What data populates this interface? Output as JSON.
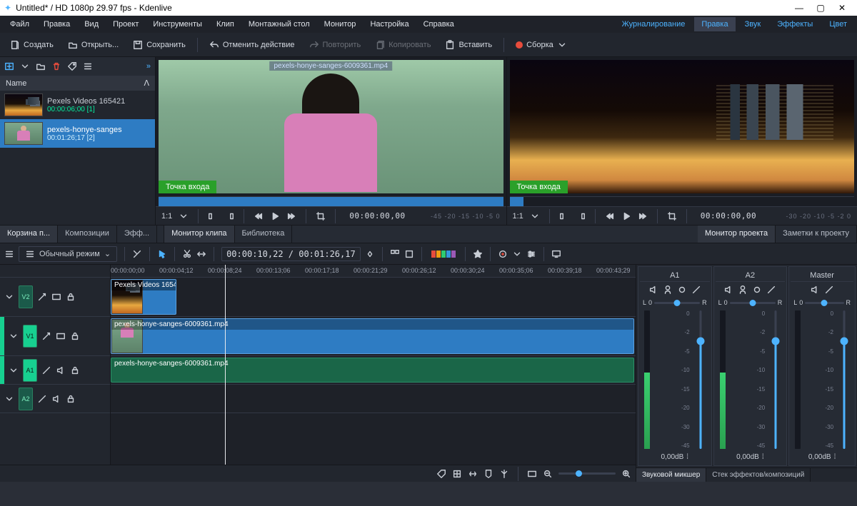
{
  "window": {
    "title": "Untitled* / HD 1080p 29.97 fps - Kdenlive"
  },
  "menu": {
    "items": [
      "Файл",
      "Правка",
      "Вид",
      "Проект",
      "Инструменты",
      "Клип",
      "Монтажный стол",
      "Монитор",
      "Настройка",
      "Справка"
    ],
    "right": [
      "Журналирование",
      "Правка",
      "Звук",
      "Эффекты",
      "Цвет"
    ]
  },
  "toolbar": {
    "new": "Создать",
    "open": "Открыть...",
    "save": "Сохранить",
    "undo": "Отменить действие",
    "redo": "Повторить",
    "copy": "Копировать",
    "paste": "Вставить",
    "render": "Сборка"
  },
  "bin": {
    "header": "Name",
    "clips": [
      {
        "name": "Pexels Videos 165421",
        "dur": "00:00:06;00 [1]"
      },
      {
        "name": "pexels-honye-sanges",
        "dur": "00:01:26;17 [2]"
      }
    ]
  },
  "tabs_left": [
    "Корзина п...",
    "Композиции",
    "Эфф..."
  ],
  "tabs_mid": [
    "Монитор клипа",
    "Библиотека"
  ],
  "tabs_right": [
    "Монитор проекта",
    "Заметки к проекту"
  ],
  "clip_monitor": {
    "overlay": "pexels-honye-sanges-6009361.mp4",
    "inpoint": "Точка входа",
    "ratio": "1:1",
    "tc": "00:00:00,00",
    "db": "-45  -20  -15  -10  -5  0"
  },
  "proj_monitor": {
    "inpoint": "Точка входа",
    "ratio": "1:1",
    "tc": "00:00:00,00",
    "db": "-30  -20  -10  -5  -2  0"
  },
  "tl_toolbar": {
    "mode": "Обычный режим",
    "tc": "00:00:10,22 / 00:01:26,17"
  },
  "ruler": [
    "00:00:00;00",
    "00:00:04;12",
    "00:00:08;24",
    "00:00:13;06",
    "00:00:17;18",
    "00:00:21;29",
    "00:00:26;12",
    "00:00:30;24",
    "00:00:35;06",
    "00:00:39;18",
    "00:00:43;29"
  ],
  "tracks": {
    "v2": {
      "label": "V2",
      "clip": "Pexels Videos 1654"
    },
    "v1": {
      "label": "V1",
      "clip": "pexels-honye-sanges-6009361.mp4"
    },
    "a1": {
      "label": "A1",
      "clip": "pexels-honye-sanges-6009361.mp4"
    },
    "a2": {
      "label": "A2"
    }
  },
  "mixer": {
    "channels": [
      {
        "name": "A1",
        "db": "0,00dB"
      },
      {
        "name": "A2",
        "db": "0,00dB"
      },
      {
        "name": "Master",
        "db": "0,00dB"
      }
    ],
    "scale": [
      "0",
      "-2",
      "-5",
      "-10",
      "-15",
      "-20",
      "-30",
      "-45"
    ],
    "pan": {
      "l": "L",
      "zero": "0",
      "r": "R"
    },
    "tabs": [
      "Звуковой микшер",
      "Стек эффектов/композиций"
    ]
  }
}
